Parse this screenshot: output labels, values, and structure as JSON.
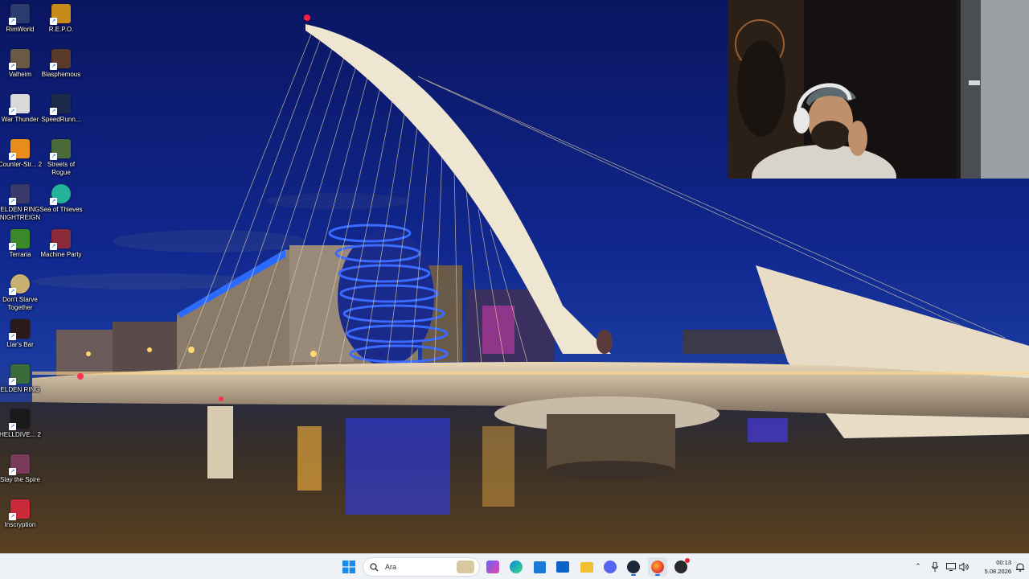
{
  "desktop": {
    "icons": [
      {
        "label": "RimWorld",
        "icon": "rimworld-icon",
        "color": "#2a3c6e"
      },
      {
        "label": "R.E.P.O.",
        "icon": "repo-icon",
        "color": "#c88a1a"
      },
      {
        "label": "Valheim",
        "icon": "valheim-icon",
        "color": "#6a5a44"
      },
      {
        "label": "Blasphemous",
        "icon": "blasphemous-icon",
        "color": "#5a3a2a"
      },
      {
        "label": "War Thunder",
        "icon": "war-thunder-icon",
        "color": "#d9d9d9"
      },
      {
        "label": "SpeedRunn...",
        "icon": "speedrunners-icon",
        "color": "#1b2a4a"
      },
      {
        "label": "Counter-Str... 2",
        "icon": "counter-strike-icon",
        "color": "#e88d1c"
      },
      {
        "label": "Streets of Rogue",
        "icon": "streets-of-rogue-icon",
        "color": "#4a6a3a"
      },
      {
        "label": "ELDEN RING NIGHTREIGN",
        "icon": "elden-ring-nightreign-icon",
        "color": "#3a3a6a"
      },
      {
        "label": "Sea of Thieves",
        "icon": "sea-of-thieves-icon",
        "color": "#22b39a"
      },
      {
        "label": "Terraria",
        "icon": "terraria-icon",
        "color": "#3a8a2a"
      },
      {
        "label": "Machine Party",
        "icon": "machine-party-icon",
        "color": "#8a2a3a"
      },
      {
        "label": "Don't Starve Together",
        "icon": "dont-starve-icon",
        "color": "#c8b070"
      },
      {
        "label": "Liar's Bar",
        "icon": "liars-bar-icon",
        "color": "#2a1a1a"
      },
      {
        "label": "ELDEN RING",
        "icon": "elden-ring-icon",
        "color": "#3a6a3a"
      },
      {
        "label": "HELLDIVE... 2",
        "icon": "helldivers-icon",
        "color": "#1a1a1a"
      },
      {
        "label": "Slay the Spire",
        "icon": "slay-the-spire-icon",
        "color": "#7a3a5a"
      },
      {
        "label": "Inscryption",
        "icon": "inscryption-icon",
        "color": "#c82a3a"
      }
    ]
  },
  "taskbar": {
    "search_placeholder": "Ara",
    "apps": [
      {
        "icon": "task-view-icon"
      },
      {
        "icon": "edge-icon"
      },
      {
        "icon": "microsoft-store-icon"
      },
      {
        "icon": "outlook-icon"
      },
      {
        "icon": "file-explorer-icon"
      },
      {
        "icon": "discord-icon"
      },
      {
        "icon": "steam-icon"
      },
      {
        "icon": "firefox-icon"
      },
      {
        "icon": "obs-icon"
      }
    ],
    "clock_time": "00:13",
    "clock_date": "5.08.2026"
  },
  "colors": {
    "taskbar_bg": "#eef1f6",
    "windows_blue": "#1a6fd8",
    "sky_top": "#0a1a5e"
  }
}
